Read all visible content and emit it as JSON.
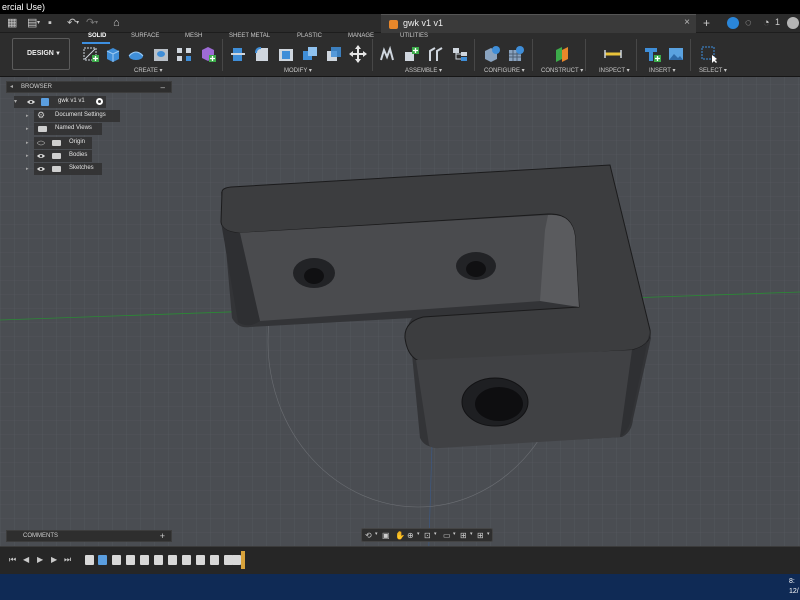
{
  "window": {
    "title": "ercial Use)"
  },
  "document_tab": {
    "name": "gwk v1 v1",
    "close_icon": "close-icon"
  },
  "account": {
    "notification_count": "1"
  },
  "workspace": {
    "label": "DESIGN"
  },
  "toolbar": {
    "tabs": [
      {
        "label": "SOLID",
        "active": true
      },
      {
        "label": "SURFACE"
      },
      {
        "label": "MESH"
      },
      {
        "label": "SHEET METAL"
      },
      {
        "label": "PLASTIC"
      },
      {
        "label": "MANAGE"
      },
      {
        "label": "UTILITIES"
      }
    ],
    "groups": [
      {
        "label": "CREATE ▾"
      },
      {
        "label": "MODIFY ▾"
      },
      {
        "label": "ASSEMBLE ▾"
      },
      {
        "label": "CONFIGURE ▾"
      },
      {
        "label": "CONSTRUCT ▾"
      },
      {
        "label": "INSPECT ▾"
      },
      {
        "label": "INSERT ▾"
      },
      {
        "label": "SELECT ▾"
      }
    ]
  },
  "browser": {
    "title": "BROWSER",
    "root": "gwk v1 v1",
    "items": [
      {
        "label": "Document Settings",
        "icon": "gear-icon"
      },
      {
        "label": "Named Views",
        "icon": "folder-icon"
      },
      {
        "label": "Origin",
        "icon": "folder-icon"
      },
      {
        "label": "Bodies",
        "icon": "folder-icon"
      },
      {
        "label": "Sketches",
        "icon": "folder-icon"
      }
    ]
  },
  "comments": {
    "title": "COMMENTS"
  },
  "colors": {
    "accent": "#3d8fe0",
    "part": "#3c3d3f",
    "grid_bg": "#4a4d52",
    "timeline_marker": "#d8a23a",
    "taskbar": "#0f2a55"
  },
  "taskbar": {
    "time": "8:",
    "date": "12/"
  }
}
